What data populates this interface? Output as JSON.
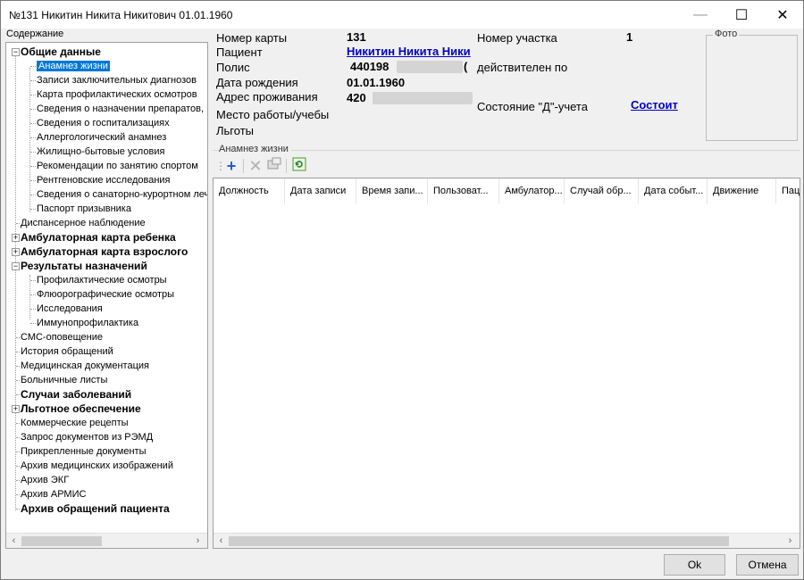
{
  "window": {
    "title": "№131 Никитин Никита Никитович 01.01.1960"
  },
  "tree": {
    "caption": "Содержание",
    "items": [
      {
        "label": "Общие данные",
        "bold": true
      },
      {
        "label": "Анамнез жизни",
        "selected": true
      },
      {
        "label": "Записи заключительных диагнозов"
      },
      {
        "label": "Карта профилактических осмотров"
      },
      {
        "label": "Сведения о назначении препаратов,"
      },
      {
        "label": "Сведения о госпитализациях"
      },
      {
        "label": "Аллергологический анамнез"
      },
      {
        "label": "Жилищно-бытовые условия"
      },
      {
        "label": "Рекомендации по занятию спортом"
      },
      {
        "label": "Рентгеновские исследования"
      },
      {
        "label": "Сведения о санаторно-курортном лече"
      },
      {
        "label": "Паспорт призывника"
      },
      {
        "label": "Диспансерное наблюдение"
      },
      {
        "label": "Амбулаторная карта ребенка",
        "bold": true
      },
      {
        "label": "Амбулаторная карта взрослого",
        "bold": true
      },
      {
        "label": "Результаты назначений",
        "bold": true
      },
      {
        "label": "Профилактические осмотры"
      },
      {
        "label": "Флюорографические осмотры"
      },
      {
        "label": "Исследования"
      },
      {
        "label": "Иммунопрофилактика"
      },
      {
        "label": "СМС-оповещение"
      },
      {
        "label": "История обращений"
      },
      {
        "label": "Медицинская документация"
      },
      {
        "label": "Больничные листы"
      },
      {
        "label": "Случаи заболеваний",
        "bold": true
      },
      {
        "label": "Льготное обеспечение",
        "bold": true
      },
      {
        "label": "Коммерческие рецепты"
      },
      {
        "label": "Запрос документов из РЭМД"
      },
      {
        "label": "Прикрепленные документы"
      },
      {
        "label": "Архив медицинских изображений"
      },
      {
        "label": "Архив ЭКГ"
      },
      {
        "label": "Архив АРМИС"
      },
      {
        "label": "Архив обращений пациента",
        "bold": true
      }
    ]
  },
  "patient": {
    "card_label": "Номер карты",
    "card_value": "131",
    "patient_label": "Пациент",
    "patient_value": "Никитин Никита Ники",
    "policy_label": "Полис",
    "policy_value": "440198",
    "policy_suffix": "(",
    "valid_label": "действителен по",
    "dob_label": "Дата рождения",
    "dob_value": "01.01.1960",
    "address_label": "Адрес проживания",
    "address_value": "420",
    "work_label": "Место работы/учебы",
    "benefits_label": "Льготы",
    "district_label": "Номер участка",
    "district_value": "1",
    "d_status_label": "Состояние \"Д\"-учета",
    "d_status_value": "Состоит",
    "photo_label": "Фото"
  },
  "section": {
    "title": "Анамнез жизни"
  },
  "toolbar": {
    "add_icon": "plus-icon",
    "delete_icon": "delete-x-icon",
    "properties_icon": "properties-icon",
    "refresh_icon": "refresh-icon"
  },
  "grid": {
    "columns": [
      "Должность",
      "Дата записи",
      "Время запи...",
      "Пользоват...",
      "Амбулатор...",
      "Случай обр...",
      "Дата событ...",
      "Движение",
      "Пац"
    ]
  },
  "buttons": {
    "ok": "Ok",
    "cancel": "Отмена"
  }
}
